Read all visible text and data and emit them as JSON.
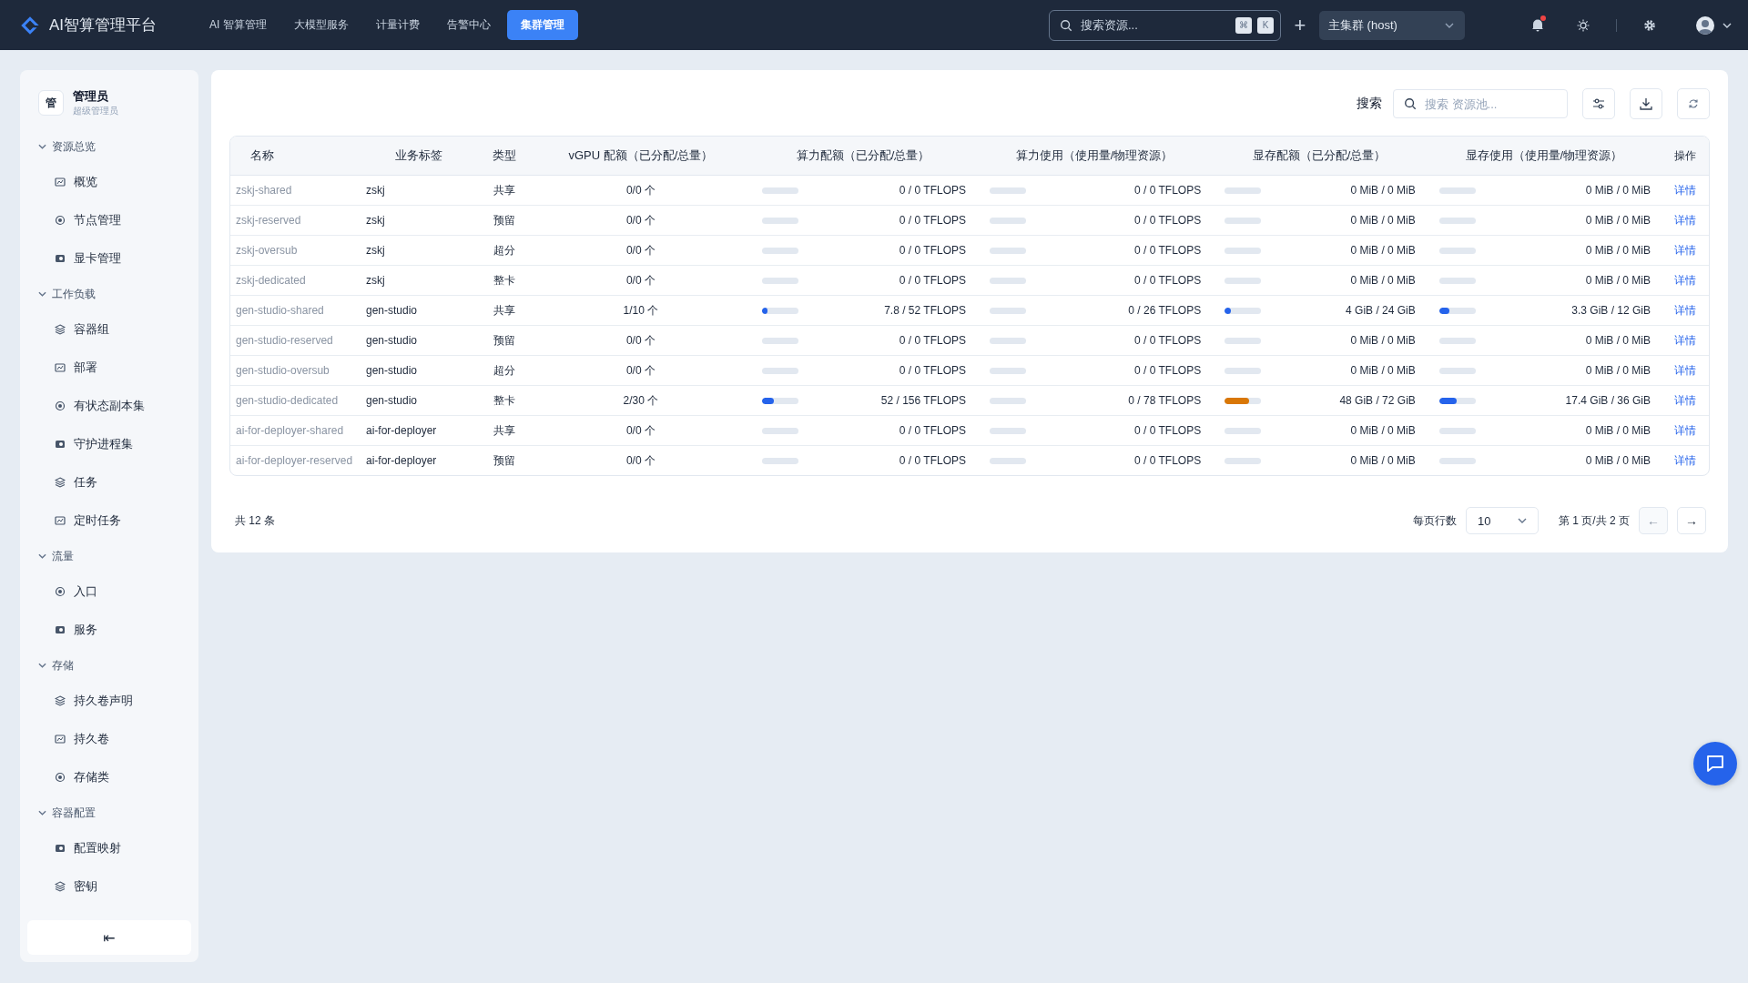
{
  "app": {
    "title": "AI智算管理平台"
  },
  "nav": [
    {
      "label": "AI 智算管理",
      "selected": false
    },
    {
      "label": "大模型服务",
      "selected": false
    },
    {
      "label": "计量计费",
      "selected": false
    },
    {
      "label": "告警中心",
      "selected": false
    },
    {
      "label": "集群管理",
      "selected": true
    }
  ],
  "global_search": {
    "placeholder": "搜索资源...",
    "keys": [
      "⌘",
      "K"
    ]
  },
  "add_button": "+",
  "cluster_select": {
    "value": "主集群 (host)"
  },
  "notifications": {
    "unread": true
  },
  "user": {
    "name": "管理员",
    "role": "超级管理员",
    "avatar_text": "管"
  },
  "sidebar": [
    {
      "label": "资源总览",
      "expanded": true,
      "items": [
        "概览",
        "节点管理",
        "显卡管理"
      ]
    },
    {
      "label": "工作负载",
      "expanded": true,
      "items": [
        "容器组",
        "部署",
        "有状态副本集",
        "守护进程集",
        "任务",
        "定时任务"
      ]
    },
    {
      "label": "流量",
      "expanded": true,
      "items": [
        "入口",
        "服务"
      ]
    },
    {
      "label": "存储",
      "expanded": true,
      "items": [
        "持久卷声明",
        "持久卷",
        "存储类"
      ]
    },
    {
      "label": "容器配置",
      "expanded": true,
      "items": [
        "配置映射",
        "密钥"
      ]
    }
  ],
  "collapse_button": "⇤",
  "toolbar": {
    "search_label": "搜索",
    "search_placeholder": "搜索 资源池..."
  },
  "table": {
    "columns": [
      "名称",
      "业务标签",
      "类型",
      "vGPU 配额（已分配/总量）",
      "算力配额（已分配/总量）",
      "算力使用（使用量/物理资源）",
      "显存配额（已分配/总量）",
      "显存使用（使用量/物理资源）",
      "操作"
    ],
    "rows": [
      {
        "name": "zskj-shared",
        "tag": "zskj",
        "type": "共享",
        "vgpu": "0/0 个",
        "bars": [
          {
            "level": 0,
            "text": "0 / 0 TFLOPS"
          },
          {
            "level": 0,
            "text": "0 / 0 TFLOPS"
          },
          {
            "level": 0,
            "text": "0 MiB / 0 MiB"
          },
          {
            "level": 0,
            "text": "0 MiB / 0 MiB"
          }
        ],
        "action": "详情"
      },
      {
        "name": "zskj-reserved",
        "tag": "zskj",
        "type": "预留",
        "vgpu": "0/0 个",
        "bars": [
          {
            "level": 0,
            "text": "0 / 0 TFLOPS"
          },
          {
            "level": 0,
            "text": "0 / 0 TFLOPS"
          },
          {
            "level": 0,
            "text": "0 MiB / 0 MiB"
          },
          {
            "level": 0,
            "text": "0 MiB / 0 MiB"
          }
        ],
        "action": "详情"
      },
      {
        "name": "zskj-oversub",
        "tag": "zskj",
        "type": "超分",
        "vgpu": "0/0 个",
        "bars": [
          {
            "level": 0,
            "text": "0 / 0 TFLOPS"
          },
          {
            "level": 0,
            "text": "0 / 0 TFLOPS"
          },
          {
            "level": 0,
            "text": "0 MiB / 0 MiB"
          },
          {
            "level": 0,
            "text": "0 MiB / 0 MiB"
          }
        ],
        "action": "详情"
      },
      {
        "name": "zskj-dedicated",
        "tag": "zskj",
        "type": "整卡",
        "vgpu": "0/0 个",
        "bars": [
          {
            "level": 0,
            "text": "0 / 0 TFLOPS"
          },
          {
            "level": 0,
            "text": "0 / 0 TFLOPS"
          },
          {
            "level": 0,
            "text": "0 MiB / 0 MiB"
          },
          {
            "level": 0,
            "text": "0 MiB / 0 MiB"
          }
        ],
        "action": "详情"
      },
      {
        "name": "gen-studio-shared",
        "tag": "gen-studio",
        "type": "共享",
        "vgpu": "1/10 个",
        "bars": [
          {
            "level": 0.15,
            "text": "7.8 / 52 TFLOPS"
          },
          {
            "level": 0,
            "text": "0 / 26 TFLOPS"
          },
          {
            "level": 0.17,
            "text": "4 GiB / 24 GiB"
          },
          {
            "level": 0.28,
            "text": "3.3 GiB / 12 GiB"
          }
        ],
        "action": "详情"
      },
      {
        "name": "gen-studio-reserved",
        "tag": "gen-studio",
        "type": "预留",
        "vgpu": "0/0 个",
        "bars": [
          {
            "level": 0,
            "text": "0 / 0 TFLOPS"
          },
          {
            "level": 0,
            "text": "0 / 0 TFLOPS"
          },
          {
            "level": 0,
            "text": "0 MiB / 0 MiB"
          },
          {
            "level": 0,
            "text": "0 MiB / 0 MiB"
          }
        ],
        "action": "详情"
      },
      {
        "name": "gen-studio-oversub",
        "tag": "gen-studio",
        "type": "超分",
        "vgpu": "0/0 个",
        "bars": [
          {
            "level": 0,
            "text": "0 / 0 TFLOPS"
          },
          {
            "level": 0,
            "text": "0 / 0 TFLOPS"
          },
          {
            "level": 0,
            "text": "0 MiB / 0 MiB"
          },
          {
            "level": 0,
            "text": "0 MiB / 0 MiB"
          }
        ],
        "action": "详情"
      },
      {
        "name": "gen-studio-dedicated",
        "tag": "gen-studio",
        "type": "整卡",
        "vgpu": "2/30 个",
        "bars": [
          {
            "level": 0.33,
            "text": "52 / 156 TFLOPS"
          },
          {
            "level": 0,
            "text": "0 / 78 TFLOPS"
          },
          {
            "level": 0.67,
            "text": "48 GiB / 72 GiB"
          },
          {
            "level": 0.48,
            "text": "17.4 GiB / 36 GiB"
          }
        ],
        "action": "详情"
      },
      {
        "name": "ai-for-deployer-shared",
        "tag": "ai-for-deployer",
        "type": "共享",
        "vgpu": "0/0 个",
        "bars": [
          {
            "level": 0,
            "text": "0 / 0 TFLOPS"
          },
          {
            "level": 0,
            "text": "0 / 0 TFLOPS"
          },
          {
            "level": 0,
            "text": "0 MiB / 0 MiB"
          },
          {
            "level": 0,
            "text": "0 MiB / 0 MiB"
          }
        ],
        "action": "详情"
      },
      {
        "name": "ai-for-deployer-reserved",
        "tag": "ai-for-deployer",
        "type": "预留",
        "vgpu": "0/0 个",
        "bars": [
          {
            "level": 0,
            "text": "0 / 0 TFLOPS"
          },
          {
            "level": 0,
            "text": "0 / 0 TFLOPS"
          },
          {
            "level": 0,
            "text": "0 MiB / 0 MiB"
          },
          {
            "level": 0,
            "text": "0 MiB / 0 MiB"
          }
        ],
        "action": "详情"
      }
    ]
  },
  "pagination": {
    "total": "共 12 条",
    "rows_label": "每页行数",
    "rows_per_page": "10",
    "page_info": "第 1 页/共 2 页",
    "prev": {
      "label": "←",
      "disabled": true
    },
    "next": {
      "label": "→",
      "disabled": false
    }
  }
}
